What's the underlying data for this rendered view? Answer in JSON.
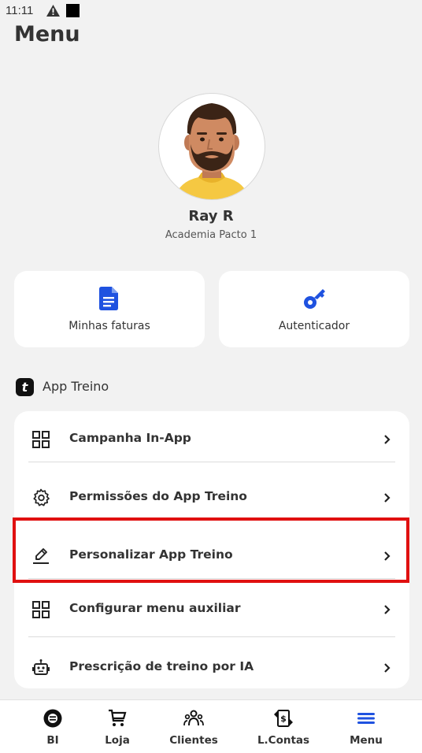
{
  "status": {
    "time": "11:11"
  },
  "header": {
    "title": "Menu"
  },
  "profile": {
    "name": "Ray R",
    "gym": "Academia Pacto 1"
  },
  "quick_actions": [
    {
      "label": "Minhas faturas",
      "icon": "invoice-file-icon"
    },
    {
      "label": "Autenticador",
      "icon": "key-icon"
    }
  ],
  "section": {
    "title": "App Treino",
    "logo_letter": "t"
  },
  "menu_items": [
    {
      "label": "Campanha In-App",
      "icon": "grid-icon"
    },
    {
      "label": "Permissões do App Treino",
      "icon": "gear-icon"
    },
    {
      "label": "Personalizar App Treino",
      "icon": "pencil-icon",
      "highlighted": true
    },
    {
      "label": "Configurar menu auxiliar",
      "icon": "grid-icon"
    },
    {
      "label": "Prescrição de treino por IA",
      "icon": "robot-icon"
    }
  ],
  "bottom_nav": [
    {
      "label": "BI",
      "icon": "bi-icon"
    },
    {
      "label": "Loja",
      "icon": "cart-icon"
    },
    {
      "label": "Clientes",
      "icon": "users-icon"
    },
    {
      "label": "L.Contas",
      "icon": "money-transfer-icon"
    },
    {
      "label": "Menu",
      "icon": "hamburger-icon",
      "active": true
    }
  ],
  "colors": {
    "accent": "#1f52e0",
    "highlight": "#e01010",
    "background": "#f2f2f2"
  }
}
